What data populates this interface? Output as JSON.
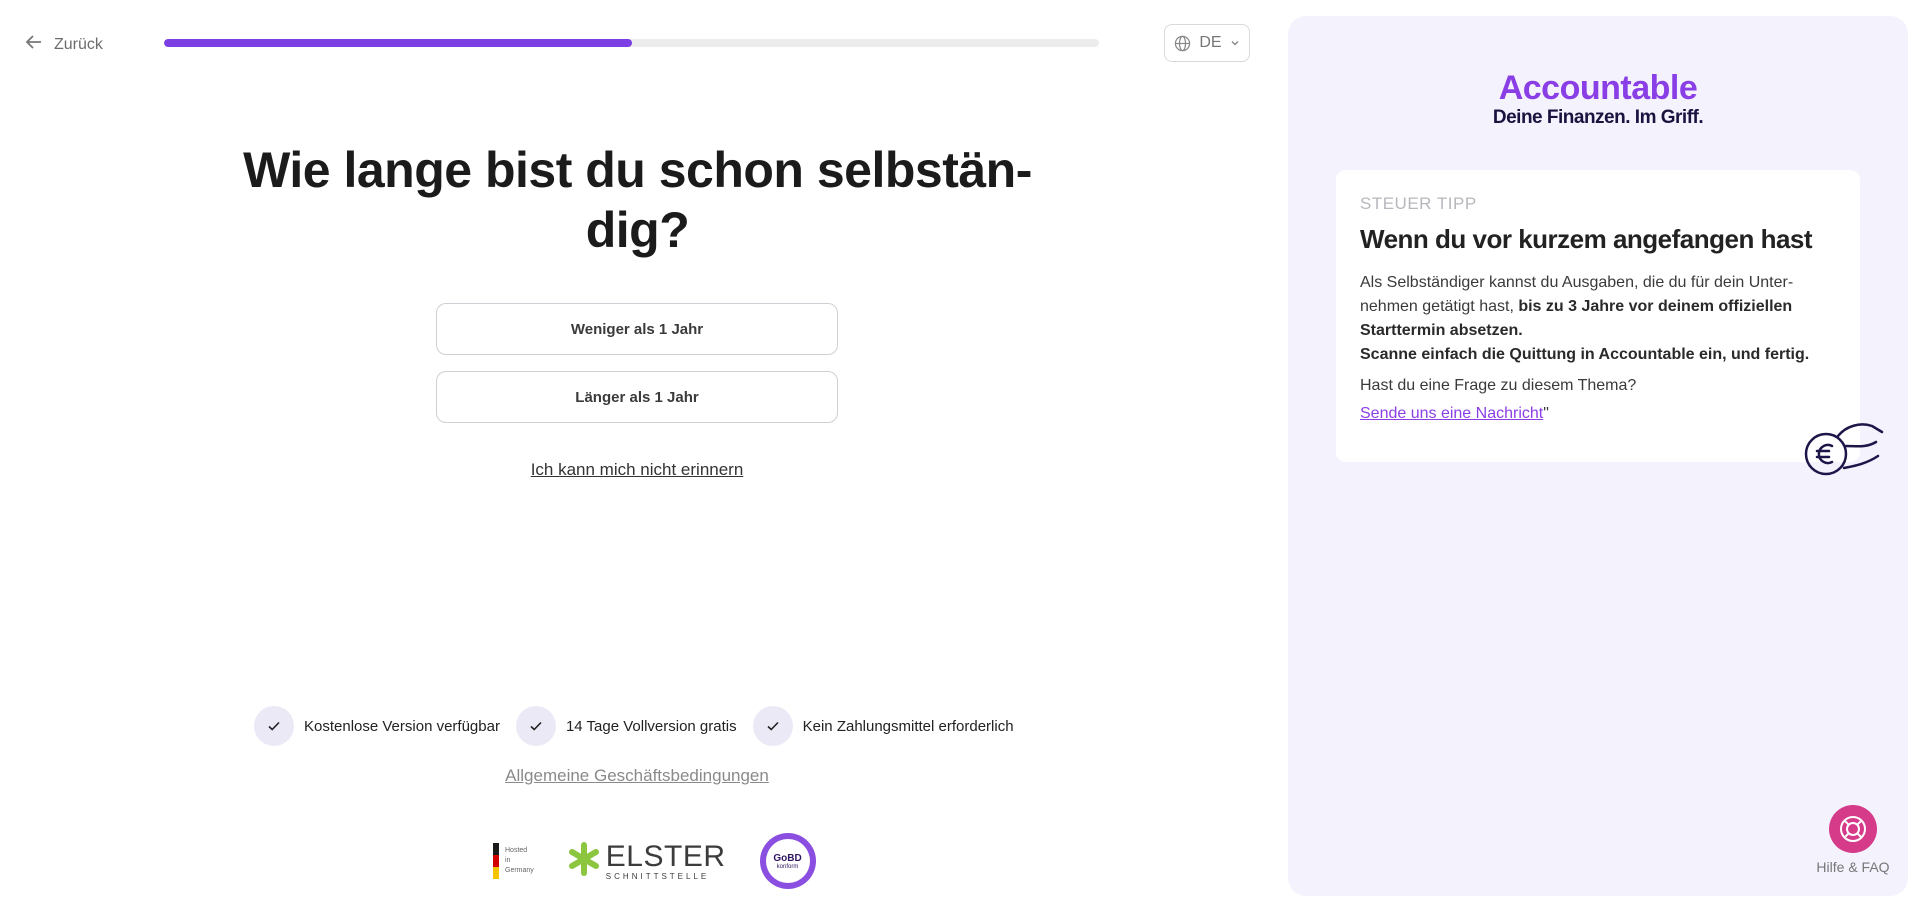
{
  "nav": {
    "back_label": "Zurück",
    "language": "DE"
  },
  "progress": {
    "value": 0.5
  },
  "question": {
    "title": "Wie lange bist du schon selbstän- dig?",
    "options": [
      "Weniger als 1 Jahr",
      "Länger als 1 Jahr"
    ],
    "forget_link": "Ich kann mich nicht erinnern"
  },
  "features": [
    "Kostenlose Version verfügbar",
    "14 Tage Vollversion gratis",
    "Kein Zahlungsmittel erforderlich"
  ],
  "agb_link": "Allgemeine Geschäftsbedingungen",
  "badges": {
    "hosted": [
      "Hosted",
      "in",
      "Germany"
    ],
    "elster": "ELSTER",
    "elster_sub": "SCHNITTSTELLE",
    "gobd": "GoBD",
    "gobd_sub": "konform"
  },
  "sidebar": {
    "logo": "Accountable",
    "slogan": "Deine Finanzen. Im Griff.",
    "tip_label": "STEUER TIPP",
    "tip_title": "Wenn du vor kurzem angefangen hast",
    "tip_text_1": "Als Selbständiger kannst du Ausgaben, die du für dein Unter- nehmen getätigt hast, ",
    "tip_text_bold": "bis zu 3 Jahre vor deinem offiziellen Starttermin absetzen.",
    "tip_text_2": "Scanne einfach die Quittung in Accountable ein, und fertig.",
    "tip_question": "Hast du eine Frage zu diesem Thema?",
    "tip_link": "Sende uns eine Nachricht",
    "tip_link_suffix": "\""
  },
  "help": {
    "label": "Hilfe & FAQ"
  },
  "colors": {
    "accent": "#7b3fe4",
    "help": "#d63b8a",
    "panel": "#f4f2fd"
  }
}
